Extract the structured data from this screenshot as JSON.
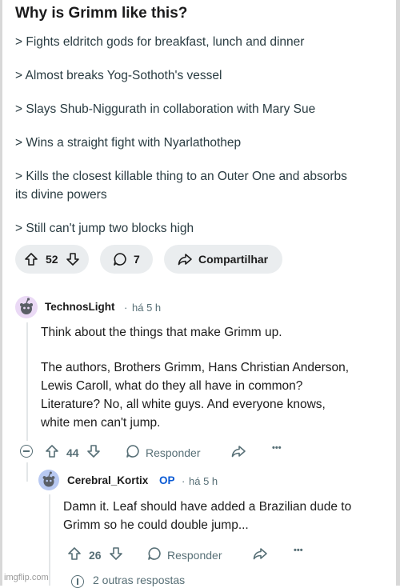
{
  "post": {
    "title": "Why is Grimm like this?",
    "lines": [
      "> Fights eldritch gods for breakfast, lunch and dinner",
      "> Almost breaks Yog-Sothoth's vessel",
      "> Slays Shub-Niggurath in collaboration with Mary Sue",
      "> Wins a straight fight with Nyarlathothep",
      "> Kills the closest killable thing to an Outer One and absorbs",
      "its divine powers",
      "> Still can't jump two blocks high"
    ],
    "votes": "52",
    "comments": "7",
    "share_label": "Compartilhar"
  },
  "comment1": {
    "author": "TechnosLight",
    "time": "há 5 h",
    "lines": [
      "Think about the things that make Grimm up.",
      "The authors, Brothers Grimm, Hans Christian Anderson,",
      "Lewis Caroll, what do they all have in common?",
      "Literature? No, all white guys. And everyone knows,",
      "white men can't jump."
    ],
    "votes": "44",
    "reply_label": "Responder",
    "more": "•••"
  },
  "comment2": {
    "author": "Cerebral_Kortix",
    "op_badge": "OP",
    "time": "há 5 h",
    "lines": [
      "Damn it. Leaf should have added a Brazilian dude to",
      "Grimm so he could double jump..."
    ],
    "votes": "26",
    "reply_label": "Responder",
    "more": "•••"
  },
  "more_replies": "2 outras respostas",
  "watermark": "imgflip.com",
  "colors": {
    "pill_bg": "#eaedef",
    "op_blue": "#0a5ad4",
    "meta_gray": "#576f76",
    "avatar1": "#ead9f5",
    "avatar2": "#b8c9f2"
  }
}
